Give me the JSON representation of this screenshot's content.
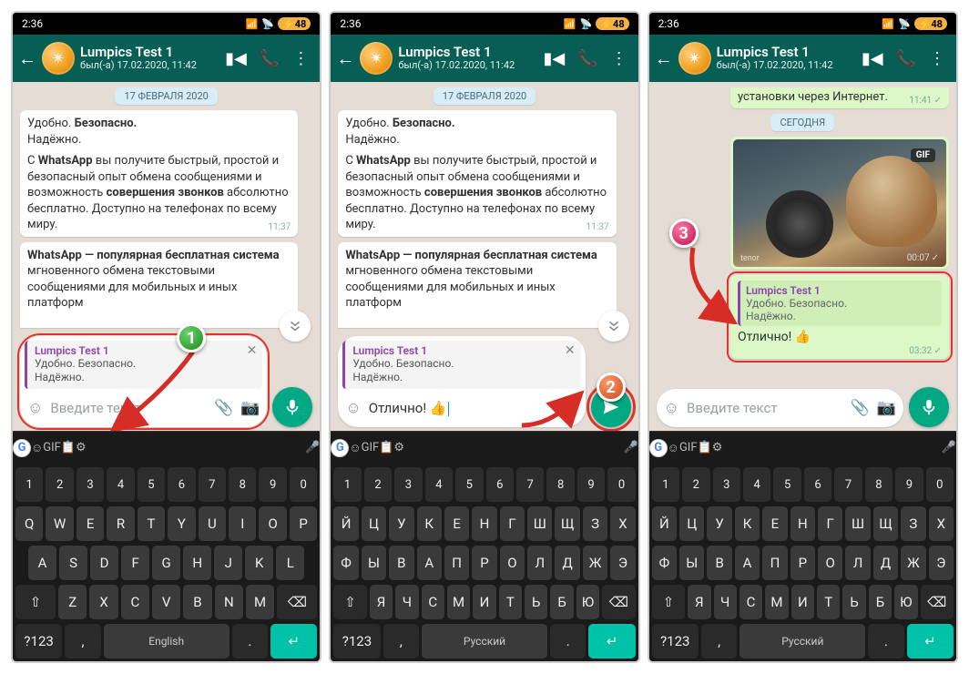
{
  "status": {
    "time": "2:36",
    "battery": "48"
  },
  "header": {
    "chat_name": "Lumpics Test 1",
    "last_seen": "был(-а) 17.02.2020, 11:42"
  },
  "date_chip": "17 ФЕВРАЛЯ 2020",
  "bubble1": {
    "l1": "Удобно. ",
    "l1b": "Безопасно.",
    "l2": "Надёжно.",
    "p2a": "С ",
    "p2b": "WhatsApp",
    "p2c": " вы получите быстрый, простой и безопасный опыт обмена сообщениями и возможность ",
    "p2d": "совершения звонков",
    "p2e": " абсолютно бесплатно. Доступно на телефонах по всему миру.",
    "time": "11:37"
  },
  "bubble2": {
    "a": "WhatsApp — популярная бесплатная система",
    "b": " мгновенного обмена текстовыми сообщениями для мобильных и иных платформ"
  },
  "compose": {
    "quote_name": "Lumpics Test 1",
    "quote_l1": "Удобно. Безопасно.",
    "quote_l2": "Надёжно.",
    "placeholder": "Введите текст",
    "typed": "Отлично! 👍"
  },
  "s3": {
    "prev_msg": "установки через Интернет.",
    "prev_time": "11:41",
    "today": "СЕГОДНЯ",
    "gif_tag": "GIF",
    "gif_wm": "tenor",
    "gif_time": "00:07",
    "reply_text": "Отлично! 👍",
    "reply_time": "03:32"
  },
  "kb": {
    "nums": [
      "1",
      "2",
      "3",
      "4",
      "5",
      "6",
      "7",
      "8",
      "9",
      "0"
    ],
    "en_r1": [
      "Q",
      "W",
      "E",
      "R",
      "T",
      "Y",
      "U",
      "I",
      "O",
      "P"
    ],
    "en_r2": [
      "A",
      "S",
      "D",
      "F",
      "G",
      "H",
      "J",
      "K",
      "L"
    ],
    "en_r3": [
      "Z",
      "X",
      "C",
      "V",
      "B",
      "N",
      "M"
    ],
    "ru_r1": [
      "Й",
      "Ц",
      "У",
      "К",
      "Е",
      "Н",
      "Г",
      "Ш",
      "Щ",
      "З",
      "Х"
    ],
    "ru_r2": [
      "Ф",
      "Ы",
      "В",
      "А",
      "П",
      "Р",
      "О",
      "Л",
      "Д",
      "Ж",
      "Э"
    ],
    "ru_r3": [
      "Я",
      "Ч",
      "С",
      "М",
      "И",
      "Т",
      "Ь",
      "Б",
      "Ю"
    ],
    "lang_en": "English",
    "lang_ru": "Русский",
    "sym": "?123",
    "strip_gif": "GIF"
  },
  "markers": {
    "m1": "1",
    "m2": "2",
    "m3": "3"
  }
}
